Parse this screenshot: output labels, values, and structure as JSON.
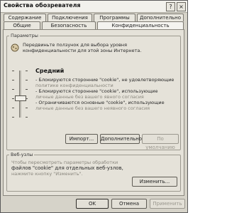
{
  "window": {
    "title": "Свойства обозревателя",
    "help_button": "?",
    "close_button": "×"
  },
  "tabs_back": [
    "Содержание",
    "Подключения",
    "Программы",
    "Дополнительно"
  ],
  "tabs_front": [
    "Общие",
    "Безопасность",
    "Конфиденциальность"
  ],
  "active_tab": "Конфиденциальность",
  "settings_group": {
    "legend": "Параметры",
    "instruction_line1": "Передвиньте ползунок для выбора уровня",
    "instruction_line2": "конфиденциальности для этой зоны Интернета.",
    "level_title": "Средний",
    "slider_level": 0.6,
    "bullets": [
      "- Блокируются сторонние \"cookie\", не удовлетворяющие",
      "  политике конфиденциальности",
      "- Блокируются сторонние \"cookie\", использующие",
      "  личные данные без вашего явного согласия",
      "- Ограничиваются основные \"cookie\", использующие",
      "  личные данные без вашего неявного согласия"
    ],
    "buttons": {
      "import": "Импорт...",
      "advanced": "Дополнительно...",
      "default": "По умолчанию"
    }
  },
  "websites_group": {
    "legend": "Веб-узлы",
    "line1": "Чтобы пересмотреть параметры обработки",
    "line2": "файлов \"cookie\" для отдельных веб-узлов,",
    "line3": "нажмите кнопку \"Изменить\".",
    "edit_button": "Изменить..."
  },
  "dialog_buttons": {
    "ok": "OK",
    "cancel": "Отмена",
    "apply": "Применить"
  }
}
